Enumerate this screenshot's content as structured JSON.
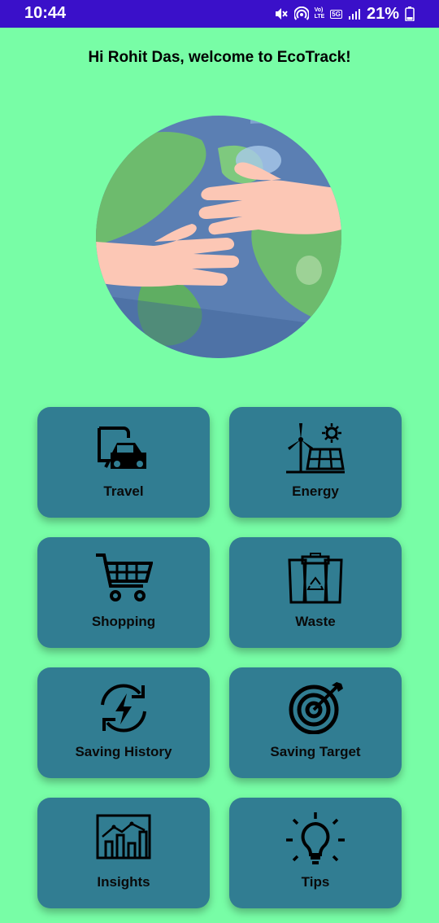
{
  "status_bar": {
    "time": "10:44",
    "network_volte": "Vo)\nLTE",
    "network_5g": "5G",
    "battery_percent": "21%",
    "icons": [
      "mute-icon",
      "hotspot-icon",
      "signal-icon",
      "battery-icon"
    ]
  },
  "header": {
    "welcome_text": "Hi Rohit Das, welcome to EcoTrack!"
  },
  "hero": {
    "icon": "earth-hands-illustration"
  },
  "tiles": [
    {
      "label": "Travel",
      "icon": "travel-icon"
    },
    {
      "label": "Energy",
      "icon": "energy-icon"
    },
    {
      "label": "Shopping",
      "icon": "shopping-cart-icon"
    },
    {
      "label": "Waste",
      "icon": "waste-bins-icon"
    },
    {
      "label": "Saving History",
      "icon": "saving-history-icon"
    },
    {
      "label": "Saving Target",
      "icon": "target-icon"
    },
    {
      "label": "Insights",
      "icon": "insights-chart-icon"
    },
    {
      "label": "Tips",
      "icon": "lightbulb-icon"
    }
  ],
  "colors": {
    "background": "#78fda6",
    "status_bar": "#3a10c9",
    "tile": "#317d92"
  }
}
